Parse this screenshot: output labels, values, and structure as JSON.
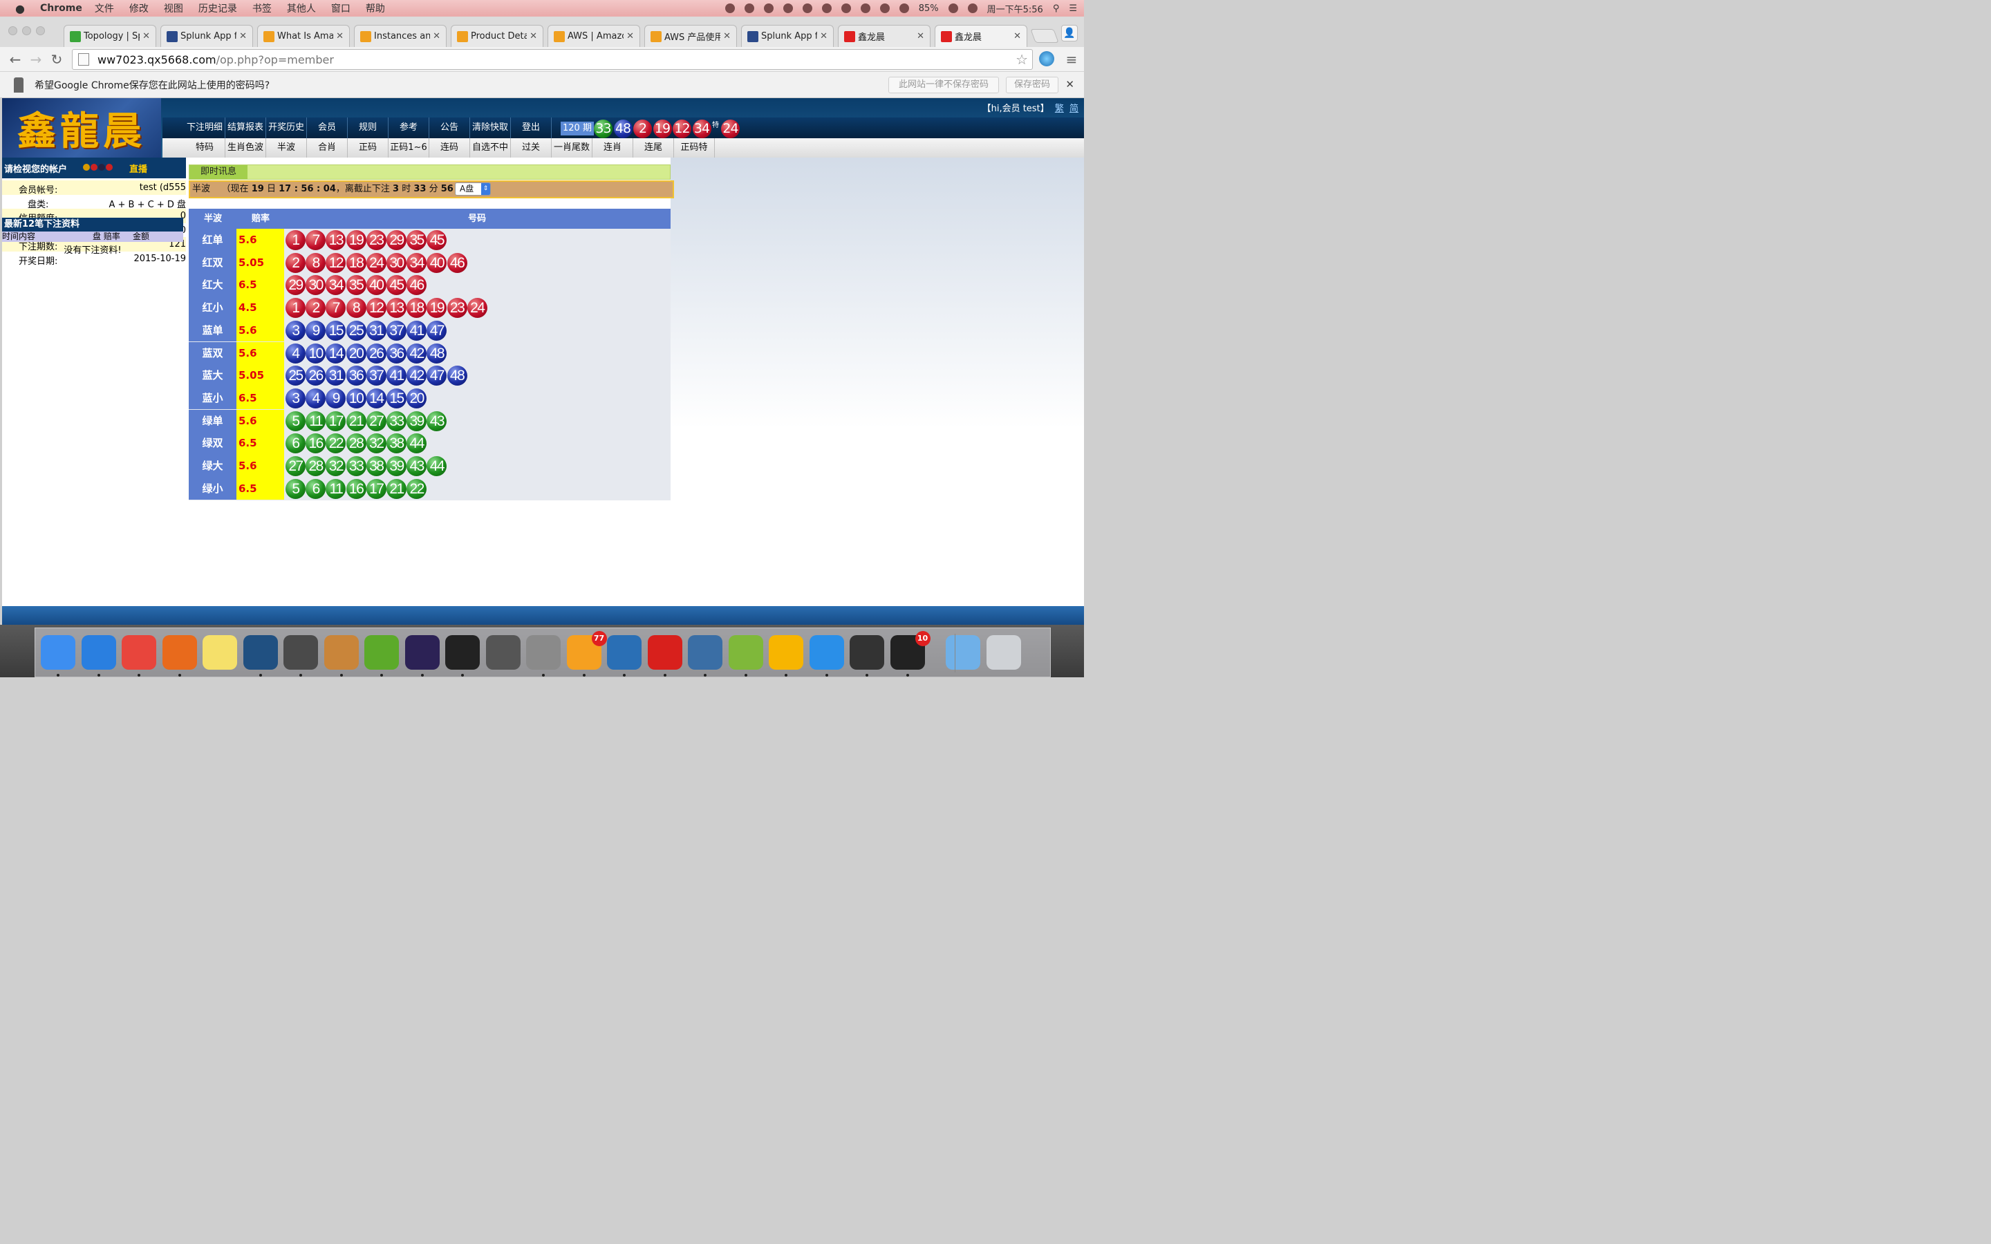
{
  "menubar": {
    "apple": "",
    "app": "Chrome",
    "items": [
      "文件",
      "修改",
      "视图",
      "历史记录",
      "书签",
      "其他人",
      "窗口",
      "帮助"
    ],
    "battery": "85%",
    "clock": "周一下午5:56"
  },
  "tabs": [
    {
      "label": "Topology | Spl",
      "icon": "terminal-icon",
      "color": "#3aa63a"
    },
    {
      "label": "Splunk App fo",
      "icon": "splunk-icon",
      "color": "#2b4a8a"
    },
    {
      "label": "What Is Amaz",
      "icon": "aws-box-icon",
      "color": "#f0a020"
    },
    {
      "label": "Instances and",
      "icon": "aws-box-icon",
      "color": "#f0a020"
    },
    {
      "label": "Product Detail",
      "icon": "aws-box-icon",
      "color": "#f0a020"
    },
    {
      "label": "AWS | Amazon",
      "icon": "aws-box-icon",
      "color": "#f0a020"
    },
    {
      "label": "AWS 产品使用",
      "icon": "aws-box-icon",
      "color": "#f0a020"
    },
    {
      "label": "Splunk App fo",
      "icon": "splunk-icon",
      "color": "#2b4a8a"
    },
    {
      "label": "鑫龙晨",
      "icon": "lottery-icon",
      "color": "#e02020"
    },
    {
      "label": "鑫龙晨",
      "icon": "lottery-icon",
      "color": "#e02020"
    }
  ],
  "omnibox": {
    "host": "ww7023.qx5668.com",
    "path": "/op.php?op=member"
  },
  "password_bar": {
    "message": "希望Google Chrome保存您在此网站上使用的密码吗?",
    "never_label": "此网站一律不保存密码",
    "save_label": "保存密码"
  },
  "site": {
    "logo": "鑫龍晨",
    "greeting": "【hi,会员 test】",
    "lang_trad": "繁",
    "lang_simp": "简"
  },
  "nav": {
    "top": [
      "下注明细",
      "结算报表",
      "开奖历史",
      "会员",
      "规则",
      "参考",
      "公告",
      "清除快取",
      "登出"
    ],
    "bottom": [
      "特码",
      "生肖色波",
      "半波",
      "合肖",
      "正码",
      "正码1~6",
      "连码",
      "自选不中",
      "过关",
      "一肖尾数",
      "连肖",
      "连尾",
      "正码特"
    ],
    "period": "120 期",
    "draw": [
      {
        "n": "33",
        "c": "green"
      },
      {
        "n": "48",
        "c": "blue"
      },
      {
        "n": "2",
        "c": "red"
      },
      {
        "n": "19",
        "c": "red"
      },
      {
        "n": "12",
        "c": "red"
      },
      {
        "n": "34",
        "c": "red"
      }
    ],
    "special_label": "特",
    "special": {
      "n": "24",
      "c": "red"
    }
  },
  "sidebar": {
    "title": "请检视您的帐户",
    "live": "直播",
    "rows": [
      {
        "k": "会员帐号:",
        "v": "test (d555"
      },
      {
        "k": "盘类:",
        "v": "A + B + C + D 盘"
      },
      {
        "k": "信用额度:",
        "v": "0"
      },
      {
        "k": "已用额度:",
        "v": "0"
      },
      {
        "k": "下注期数:",
        "v": "121"
      },
      {
        "k": "开奖日期:",
        "v": "2015-10-19"
      }
    ],
    "recent_title": "最新12笔下注资料",
    "recent_cols": [
      "时间内容",
      "盘 赔率",
      "金额"
    ],
    "recent_empty": "没有下注资料!"
  },
  "main": {
    "notice_label": "即时讯息",
    "status": {
      "type": "半波",
      "prefix": "（现在",
      "day": "19",
      "day_suffix": "日",
      "time": "17 : 56 : 04",
      "mid": "，离截止下注",
      "hours": "3",
      "h": "时",
      "mins": "33",
      "m": "分",
      "secs": "56",
      "s": "秒 ）"
    },
    "market": "A盘",
    "table_headers": [
      "半波",
      "赔率",
      "号码"
    ],
    "rows": [
      {
        "name": "红单",
        "odds": "5.6",
        "color": "red",
        "nums": [
          "1",
          "7",
          "13",
          "19",
          "23",
          "29",
          "35",
          "45"
        ]
      },
      {
        "name": "红双",
        "odds": "5.05",
        "color": "red",
        "nums": [
          "2",
          "8",
          "12",
          "18",
          "24",
          "30",
          "34",
          "40",
          "46"
        ]
      },
      {
        "name": "红大",
        "odds": "6.5",
        "color": "red",
        "nums": [
          "29",
          "30",
          "34",
          "35",
          "40",
          "45",
          "46"
        ]
      },
      {
        "name": "红小",
        "odds": "4.5",
        "color": "red",
        "nums": [
          "1",
          "2",
          "7",
          "8",
          "12",
          "13",
          "18",
          "19",
          "23",
          "24"
        ]
      },
      {
        "name": "蓝单",
        "odds": "5.6",
        "color": "blue",
        "nums": [
          "3",
          "9",
          "15",
          "25",
          "31",
          "37",
          "41",
          "47"
        ]
      },
      {
        "name": "蓝双",
        "odds": "5.6",
        "color": "blue",
        "nums": [
          "4",
          "10",
          "14",
          "20",
          "26",
          "36",
          "42",
          "48"
        ]
      },
      {
        "name": "蓝大",
        "odds": "5.05",
        "color": "blue",
        "nums": [
          "25",
          "26",
          "31",
          "36",
          "37",
          "41",
          "42",
          "47",
          "48"
        ]
      },
      {
        "name": "蓝小",
        "odds": "6.5",
        "color": "blue",
        "nums": [
          "3",
          "4",
          "9",
          "10",
          "14",
          "15",
          "20"
        ]
      },
      {
        "name": "绿单",
        "odds": "5.6",
        "color": "green",
        "nums": [
          "5",
          "11",
          "17",
          "21",
          "27",
          "33",
          "39",
          "43"
        ]
      },
      {
        "name": "绿双",
        "odds": "6.5",
        "color": "green",
        "nums": [
          "6",
          "16",
          "22",
          "28",
          "32",
          "38",
          "44"
        ]
      },
      {
        "name": "绿大",
        "odds": "5.6",
        "color": "green",
        "nums": [
          "27",
          "28",
          "32",
          "33",
          "38",
          "39",
          "43",
          "44"
        ]
      },
      {
        "name": "绿小",
        "odds": "6.5",
        "color": "green",
        "nums": [
          "5",
          "6",
          "11",
          "16",
          "17",
          "21",
          "22"
        ]
      }
    ]
  },
  "dock": [
    {
      "name": "finder-icon",
      "color": "#3d8ef0"
    },
    {
      "name": "safari-icon",
      "color": "#2a7fe0"
    },
    {
      "name": "chrome-icon",
      "color": "#e8453c"
    },
    {
      "name": "firefox-icon",
      "color": "#e86a1c"
    },
    {
      "name": "stickies-icon",
      "color": "#f5e06a"
    },
    {
      "name": "sourcetree-icon",
      "color": "#205081"
    },
    {
      "name": "sublime-icon",
      "color": "#4a4a4a"
    },
    {
      "name": "dbeaver-icon",
      "color": "#c9853a"
    },
    {
      "name": "evernote-icon",
      "color": "#5caa2a"
    },
    {
      "name": "eclipse-icon",
      "color": "#2c2255"
    },
    {
      "name": "terminal-icon",
      "color": "#222222"
    },
    {
      "name": "markdown-icon",
      "color": "#555555"
    },
    {
      "name": "system-preferences-icon",
      "color": "#8a8a8a"
    },
    {
      "name": "opera-icon",
      "color": "#f5a020",
      "badge": "77"
    },
    {
      "name": "chat-icon",
      "color": "#2a6fb5"
    },
    {
      "name": "netease-music-icon",
      "color": "#d8201c"
    },
    {
      "name": "virtualbox-icon",
      "color": "#3a6ea5"
    },
    {
      "name": "android-studio-icon",
      "color": "#7fb83a"
    },
    {
      "name": "sketch-icon",
      "color": "#f7b500"
    },
    {
      "name": "xcode-icon",
      "color": "#2a8fe8"
    },
    {
      "name": "windows-xp-vm-icon",
      "color": "#333333"
    },
    {
      "name": "qq-icon",
      "color": "#222222",
      "badge": "10"
    },
    {
      "name": "downloads-icon",
      "color": "#6fb0e8"
    },
    {
      "name": "trash-icon",
      "color": "#cfd2d6"
    }
  ]
}
